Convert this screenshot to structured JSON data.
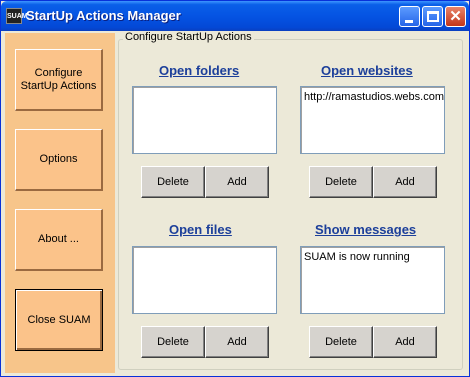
{
  "window": {
    "title": "StartUp Actions Manager",
    "icon_text": "SUAM"
  },
  "sidebar": {
    "items": [
      {
        "label": "Configure StartUp Actions"
      },
      {
        "label": "Options"
      },
      {
        "label": "About ..."
      },
      {
        "label": "Close SUAM"
      }
    ]
  },
  "main": {
    "group_label": "Configure StartUp Actions",
    "sections": {
      "open_folders": {
        "title": "Open folders",
        "items": [],
        "delete_label": "Delete",
        "add_label": "Add"
      },
      "open_websites": {
        "title": "Open websites",
        "items": [
          "http://ramastudios.webs.com"
        ],
        "delete_label": "Delete",
        "add_label": "Add"
      },
      "open_files": {
        "title": "Open files",
        "items": [],
        "delete_label": "Delete",
        "add_label": "Add"
      },
      "show_messages": {
        "title": "Show messages",
        "items": [
          "SUAM is now running"
        ],
        "delete_label": "Delete",
        "add_label": "Add"
      }
    }
  },
  "colors": {
    "titlebar": "#0554e3",
    "sidebar_bg": "#f7c58a",
    "section_title": "#1c3f9a"
  }
}
